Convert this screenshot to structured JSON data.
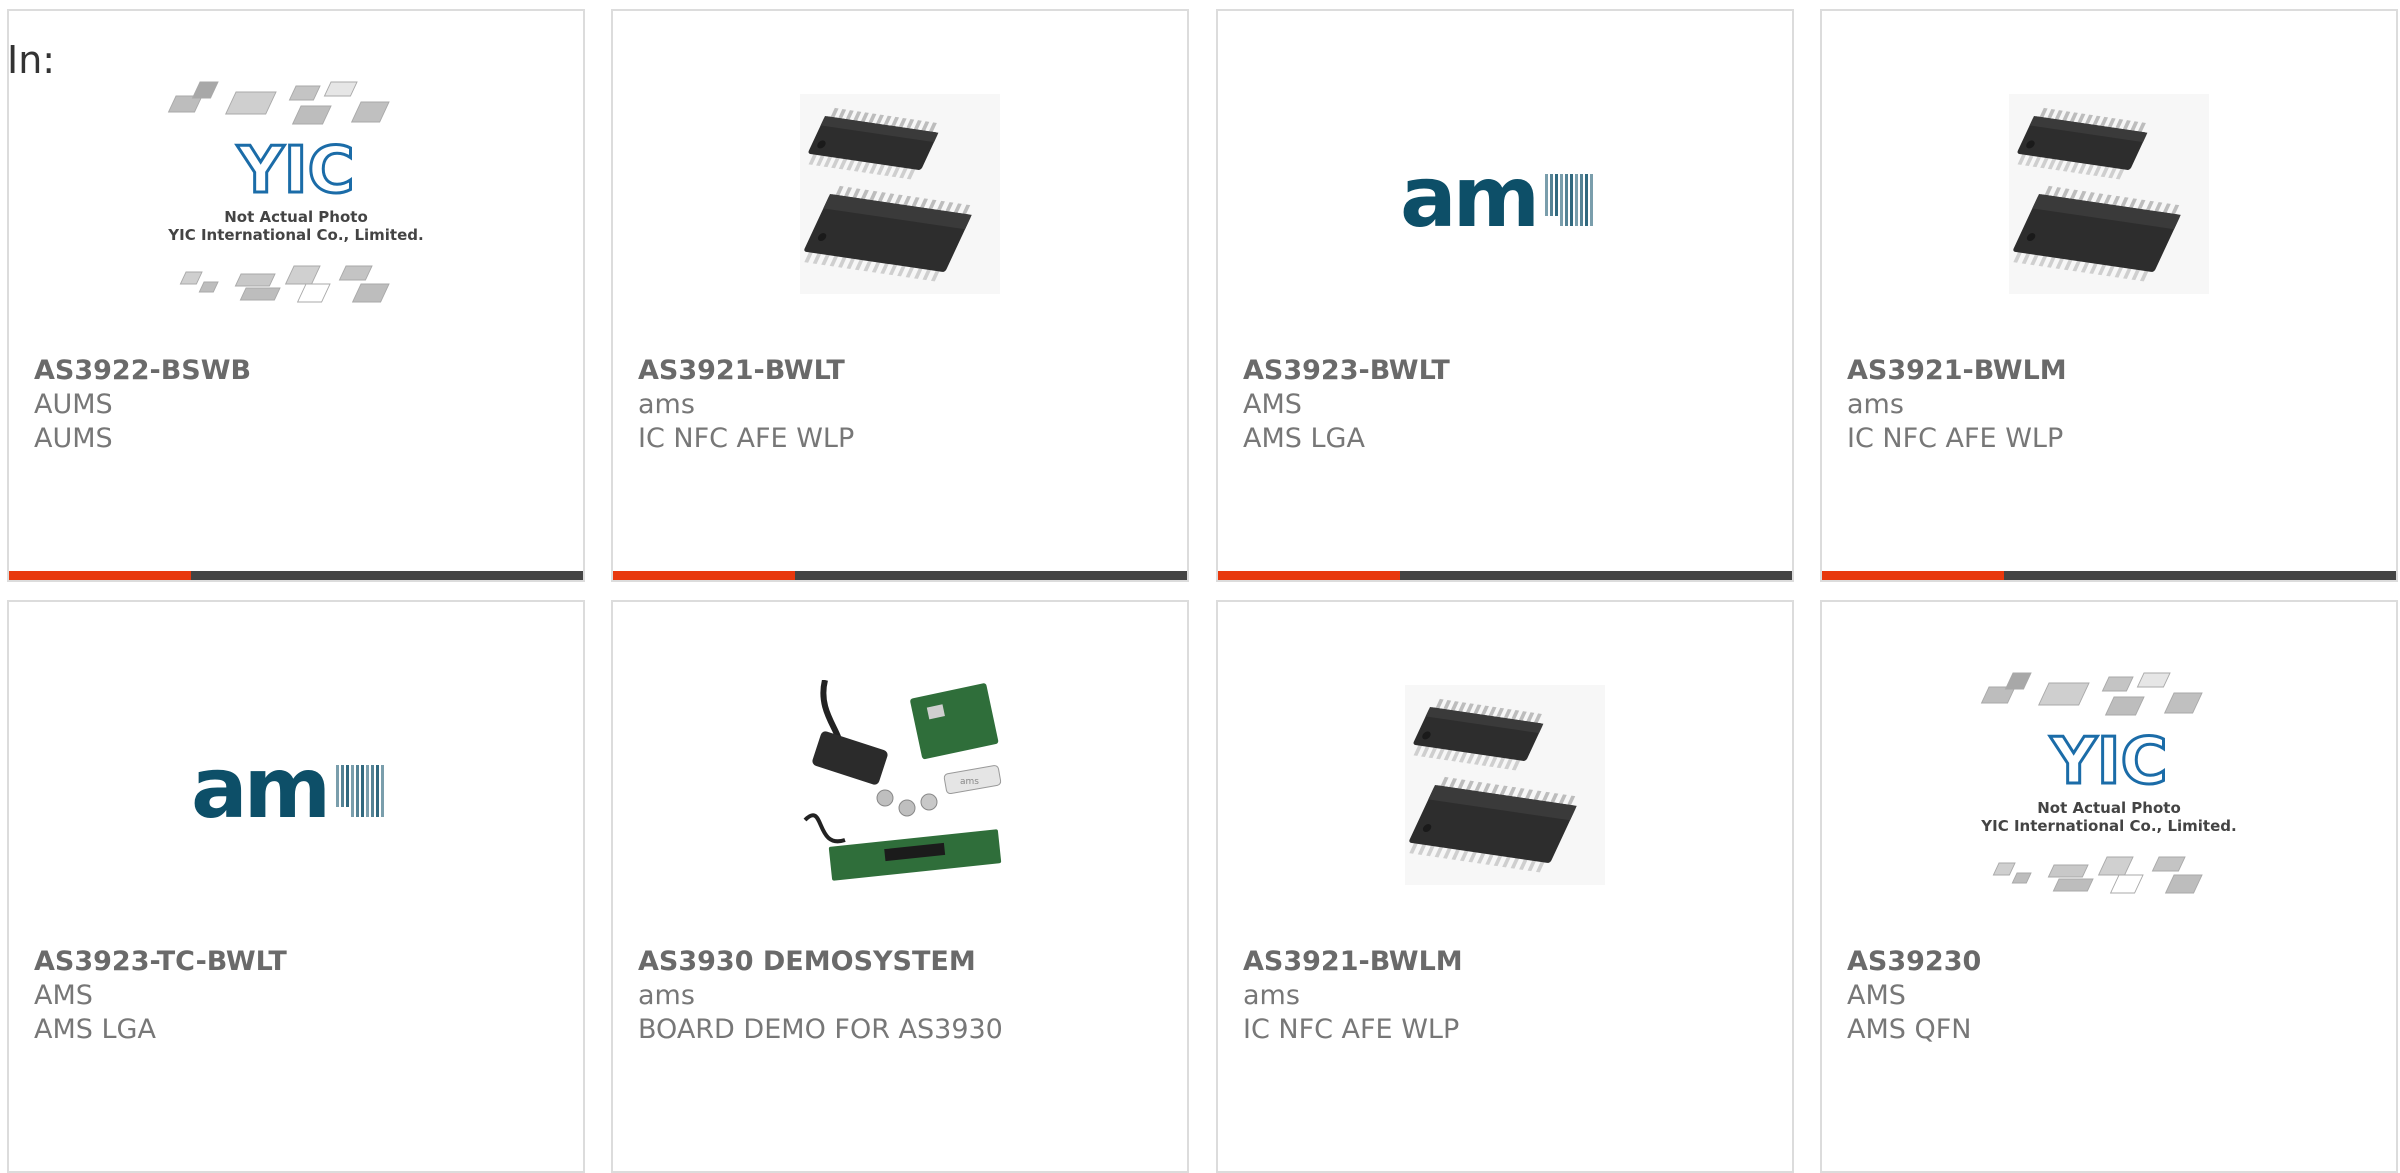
{
  "filter_label": "In:",
  "placeholder_caption": [
    "Not Actual Photo",
    "YIC International Co., Limited."
  ],
  "placeholder_logo": "YIC",
  "ams_logo_text": "am",
  "board_logo_text": "ams",
  "colors": {
    "accent": "#e8380d",
    "bar": "#444444",
    "ams_logo": "#0d4f68",
    "yic_logo": "#1b6ca8",
    "border": "#dcdcdc",
    "text": "#6a6a6a"
  },
  "products": [
    {
      "part": "AS3922-BSWB",
      "manufacturer": "AUMS",
      "description": "AUMS",
      "image": "not-actual-photo"
    },
    {
      "part": "AS3921-BWLT",
      "manufacturer": "ams",
      "description": "IC NFC AFE WLP",
      "image": "ic-chip"
    },
    {
      "part": "AS3923-BWLT",
      "manufacturer": "AMS",
      "description": "AMS LGA",
      "image": "ams-logo"
    },
    {
      "part": "AS3921-BWLM",
      "manufacturer": "ams",
      "description": "IC NFC AFE WLP",
      "image": "ic-chip"
    },
    {
      "part": "AS3923-TC-BWLT",
      "manufacturer": "AMS",
      "description": "AMS LGA",
      "image": "ams-logo"
    },
    {
      "part": "AS3930 DEMOSYSTEM",
      "manufacturer": "ams",
      "description": "BOARD DEMO FOR AS3930",
      "image": "demo-board"
    },
    {
      "part": "AS3921-BWLM",
      "manufacturer": "ams",
      "description": "IC NFC AFE WLP",
      "image": "ic-chip"
    },
    {
      "part": "AS39230",
      "manufacturer": "AMS",
      "description": "AMS QFN",
      "image": "not-actual-photo"
    }
  ]
}
